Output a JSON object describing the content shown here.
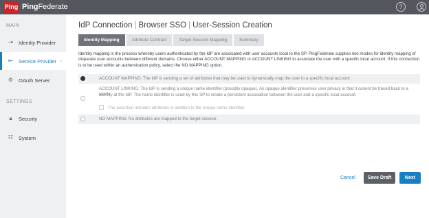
{
  "header": {
    "logo_text": "Ping",
    "product_bold": "Ping",
    "product_rest": "Federate",
    "help_icon": "question-circle-icon",
    "user_icon": "user-circle-icon"
  },
  "sidebar": {
    "main_label": "MAIN",
    "settings_label": "SETTINGS",
    "items": [
      {
        "label": "Identity Provider",
        "icon": "idp-icon"
      },
      {
        "label": "Service Provider",
        "icon": "sp-icon"
      },
      {
        "label": "OAuth Server",
        "icon": "oauth-icon"
      },
      {
        "label": "Security",
        "icon": "lock-icon"
      },
      {
        "label": "System",
        "icon": "sliders-icon"
      }
    ]
  },
  "title": {
    "part1": "IdP Connection",
    "part2": "Browser SSO",
    "part3": "User-Session Creation",
    "separator": "|"
  },
  "tabs": [
    {
      "label": "Identity Mapping",
      "active": true
    },
    {
      "label": "Attribute Contract",
      "active": false
    },
    {
      "label": "Target Session Mapping",
      "active": false
    },
    {
      "label": "Summary",
      "active": false
    }
  ],
  "description": "Identity mapping is the process whereby users authenticated by the IdP are associated with user accounts local to the SP. PingFederate supplies two modes for identity mapping of disparate user accounts between different domains. Choose either ACCOUNT MAPPING or ACCOUNT LINKING to associate the user with a specific local account. If this connection is to be used within an authentication policy, select the NO MAPPING option.",
  "options": {
    "account_mapping": "ACCOUNT MAPPING: The IdP is sending a set of attributes that may be used to dynamically map the user to a specific local account.",
    "account_linking_1": "ACCOUNT LINKING: The IdP is sending a unique name identifier (possibly opaque). An opaque identifier preserves user privacy in that it cannot be traced back to a user's",
    "account_linking_2": "identity at the IdP. The name identifier is used by this SP to create a persistent association between the user and a specific local account.",
    "assertion_checkbox": "The assertion includes attributes in addition to the unique name identifier.",
    "no_mapping": "NO MAPPING: No attributes are mapped to the target session.",
    "selected": "ACCOUNT MAPPING"
  },
  "actions": {
    "cancel": "Cancel",
    "save_draft": "Save Draft",
    "next": "Next"
  },
  "colors": {
    "topbar": "#54575d",
    "brand_red": "#cc2229",
    "accent_blue": "#1a7fc2"
  }
}
